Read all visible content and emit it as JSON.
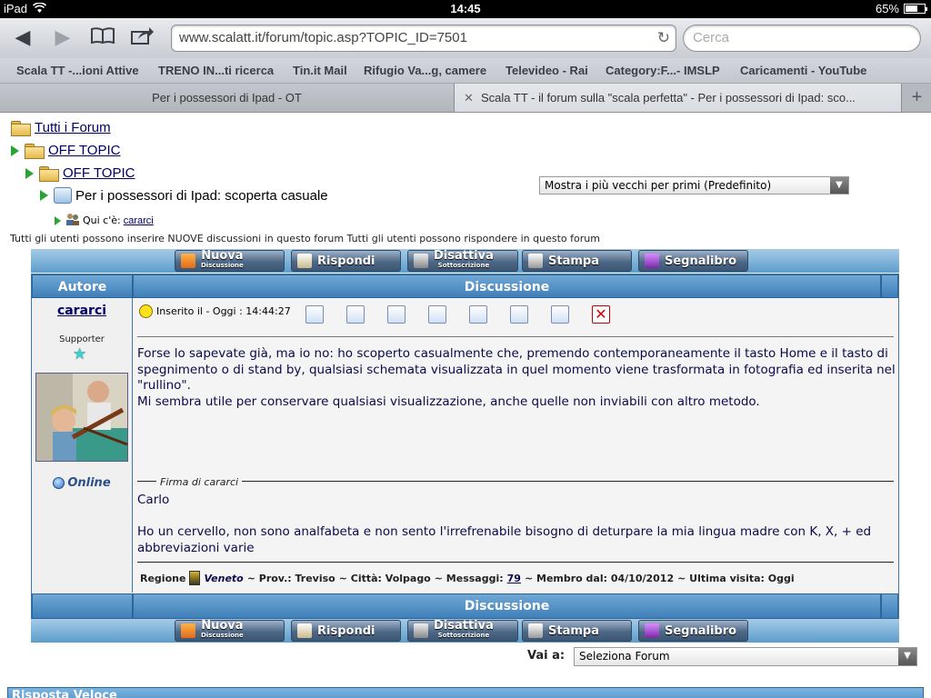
{
  "status": {
    "device": "iPad",
    "time": "14:45",
    "battery": "65%",
    "battery_level": 0.65
  },
  "browser": {
    "url": "www.scalatt.it/forum/topic.asp?TOPIC_ID=7501",
    "search_placeholder": "Cerca",
    "bookmarks": [
      "Scala TT -...ioni Attive",
      "TRENO IN...ti ricerca",
      "Tin.it Mail",
      "Rifugio Va...g, camere",
      "Televideo - Rai",
      "Category:F...- IMSLP",
      "Caricamenti - YouTube"
    ],
    "tabs": [
      "Per i possessori di Ipad - OT",
      "Scala TT - il forum sulla \"scala perfetta\" - Per i possessori di Ipad: sco..."
    ],
    "icons": [
      "back-icon",
      "forward-icon",
      "bookmarks-icon",
      "share-icon",
      "reload-icon",
      "close-icon",
      "add-tab-icon"
    ]
  },
  "breadcrumb": {
    "all_forums": "Tutti i Forum",
    "cat": "OFF TOPIC",
    "forum": "OFF TOPIC",
    "topic": "Per i possessori di Ipad: scoperta casuale",
    "here_label": "Qui c'è:",
    "here_user": "cararci"
  },
  "sort_select": "Mostra i più vecchi per primi (Predefinito)",
  "permissions": "Tutti gli utenti possono inserire NUOVE discussioni in questo forum Tutti gli utenti possono rispondere in questo forum",
  "buttons": {
    "new": "Nuova",
    "new_sub": "Discussione",
    "reply": "Rispondi",
    "disable": "Disattiva",
    "disable_sub": "Sottoscrizione",
    "print": "Stampa",
    "bookmark": "Segnalibro"
  },
  "table": {
    "col_author": "Autore",
    "col_topic": "Discussione",
    "footer": "Discussione"
  },
  "post": {
    "author": "cararci",
    "role": "Supporter",
    "online": "Online",
    "posted": "Inserito il - Oggi : 14:44:27",
    "body_lines": [
      "Forse lo sapevate già, ma io no: ho scoperto casualmente che, premendo contemporaneamente il tasto Home e il tasto di spegnimento o di stand by, qualsiasi schemata visualizzata in quel momento viene trasformata in fotografia ed inserita nel \"rullino\".",
      "Mi sembra utile per conservare qualsiasi visualizzazione, anche quelle non inviabili con altro metodo."
    ],
    "sig_label": "Firma di cararci",
    "sig_name": "Carlo",
    "sig_quote": "Ho un cervello, non sono analfabeta e non sento l'irrefrenabile bisogno di deturpare la mia lingua madre con K, X, + ed abbreviazioni varie",
    "info": {
      "region_label": "Regione",
      "region": "Veneto",
      "prov": "~ Prov.: Treviso",
      "city": "~ Città: Volpago",
      "msgs_label": "~  Messaggi:",
      "msgs": "79",
      "member": "~  Membro dal: 04/10/2012",
      "last": "~  Ultima visita: Oggi"
    }
  },
  "goto": {
    "label": "Vai a:",
    "select": "Seleziona Forum"
  },
  "quick_reply": "Risposta Veloce"
}
